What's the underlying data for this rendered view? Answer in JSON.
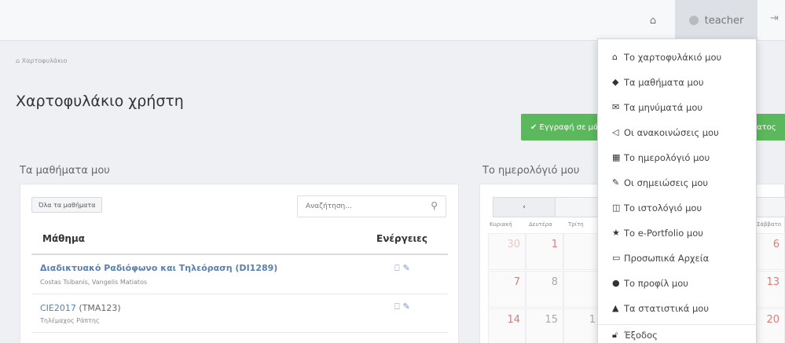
{
  "topbar": {
    "home_icon": "home-icon",
    "user_name": "teacher",
    "exit_icon": "logout-icon"
  },
  "breadcrumb": "Χαρτοφυλάκιο",
  "page_title": "Χαρτοφυλάκιο χρήστη",
  "register_button": "✔ Εγγραφή σε μάθημα",
  "register_button_suffix": "ατος",
  "courses": {
    "section_title": "Τα μαθήματα μου",
    "all_button": "Όλα τα μαθήματα",
    "search_placeholder": "Αναζήτηση...",
    "col_course": "Μάθημα",
    "col_actions": "Ενέργειες",
    "rows": [
      {
        "title": "Διαδικτυακό Ραδιόφωνο και Τηλεόραση (DI1289)",
        "code": "(DI1289)",
        "teachers": "Costas Tsibanis, Vangelis Matiatos"
      },
      {
        "title": "CIE2017",
        "code": "(TMA123)",
        "teachers": "Τηλέμαχος Ράπτης"
      }
    ]
  },
  "calendar": {
    "section_title": "Το ημερολόγιό μου",
    "prev_label": "‹",
    "days": [
      "Κυριακή",
      "Δευτέρα",
      "Τρίτη"
    ],
    "last_day": "Σάββατο",
    "dates": [
      "30",
      "1",
      "7",
      "8",
      "14",
      "15",
      "1"
    ],
    "right_dates": [
      "6",
      "13",
      "20"
    ]
  },
  "user_menu": {
    "items": [
      {
        "icon": "home-icon",
        "label": "Το χαρτοφυλάκιό μου"
      },
      {
        "icon": "graduation-cap-icon",
        "label": "Τα μαθήματα μου"
      },
      {
        "icon": "envelope-icon",
        "label": "Τα μηνύματά μου"
      },
      {
        "icon": "bullhorn-icon",
        "label": "Οι ανακοινώσεις μου"
      },
      {
        "icon": "calendar-icon",
        "label": "Το ημερολόγιό μου"
      },
      {
        "icon": "edit-icon",
        "label": "Οι σημειώσεις μου"
      },
      {
        "icon": "columns-icon",
        "label": "Το ιστολόγιό μου"
      },
      {
        "icon": "star-icon",
        "label": "Το e-Portfolio μου"
      },
      {
        "icon": "folder-icon",
        "label": "Προσωπικά Αρχεία"
      },
      {
        "icon": "user-icon",
        "label": "Το προφίλ μου"
      },
      {
        "icon": "chart-icon",
        "label": "Τα στατιστικά μου"
      },
      {
        "icon": "unlock-icon",
        "label": "Έξοδος"
      }
    ]
  }
}
